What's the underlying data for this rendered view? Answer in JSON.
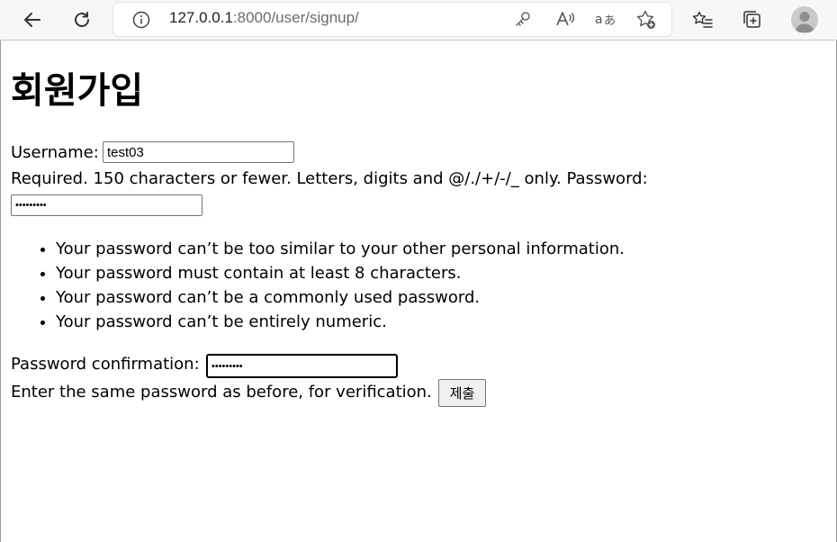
{
  "browser": {
    "url_host": "127.0.0.1",
    "url_rest": ":8000/user/signup/",
    "icons": [
      "back-arrow-icon",
      "refresh-icon",
      "info-icon",
      "key-icon",
      "read-aloud-icon",
      "translate-icon",
      "favorite-add-icon",
      "favorites-list-icon",
      "collections-icon",
      "profile-avatar-icon"
    ]
  },
  "page": {
    "title": "회원가입",
    "username_label": "Username:",
    "username_value": "test03",
    "username_help": "Required. 150 characters or fewer. Letters, digits and @/./+/-/_ only.",
    "password_label": "Password:",
    "password_value": "•••••••••",
    "password_help": [
      "Your password can’t be too similar to your other personal information.",
      "Your password must contain at least 8 characters.",
      "Your password can’t be a commonly used password.",
      "Your password can’t be entirely numeric."
    ],
    "confirm_label": "Password confirmation:",
    "confirm_value": "•••••••••",
    "confirm_help": "Enter the same password as before, for verification.",
    "submit_label": "제출"
  }
}
